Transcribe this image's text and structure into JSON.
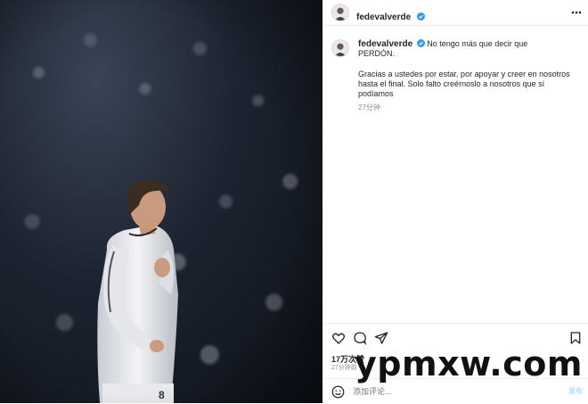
{
  "post": {
    "author": "fedevalverde",
    "caption_line1": "No tengo más que decir que",
    "caption_line2": "PERDÓN.",
    "caption_para1": "Gracias a ustedes por estar, por apoyar y creer en nosotros",
    "caption_para2": "hasta el final. Solo falto creérnoslo a nosotros que sí podíamos",
    "caption_time": "27分钟",
    "likes": "17万次赞",
    "post_time": "27分钟前",
    "comment_placeholder": "添加评论...",
    "post_button": "发布"
  },
  "photo": {
    "jersey_number": "8"
  },
  "watermark": "ypmxw.com",
  "colors": {
    "verified": "#3897f0",
    "text": "#262626",
    "secondary": "#8e8e8e",
    "divider": "#efefef"
  },
  "icons": [
    "more-options-icon",
    "verified-badge-icon",
    "heart-icon",
    "comment-icon",
    "share-icon",
    "bookmark-icon",
    "emoji-icon"
  ]
}
